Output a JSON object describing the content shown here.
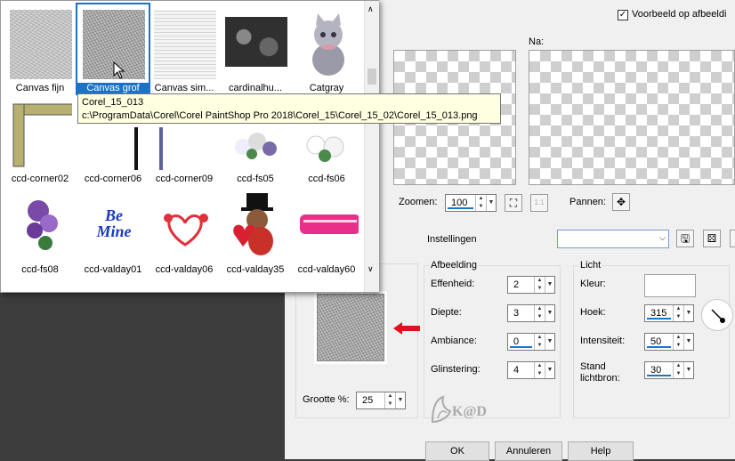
{
  "header": {
    "preview_checkbox_label": "Voorbeeld op afbeeldi",
    "after_label": "Na:"
  },
  "zoom": {
    "label": "Zoomen:",
    "value": "100",
    "pan_label": "Pannen:"
  },
  "settings": {
    "label": "Instellingen",
    "value": ""
  },
  "texture": {
    "size_label": "Grootte %:",
    "size_value": "25"
  },
  "afbeelding": {
    "title": "Afbeelding",
    "fields": [
      {
        "label": "Effenheid:",
        "value": "2"
      },
      {
        "label": "Diepte:",
        "value": "3"
      },
      {
        "label": "Ambiance:",
        "value": "0"
      },
      {
        "label": "Glinstering:",
        "value": "4"
      }
    ]
  },
  "licht": {
    "title": "Licht",
    "kleur_label": "Kleur:",
    "hoek_label": "Hoek:",
    "hoek_value": "315",
    "intensiteit_label": "Intensiteit:",
    "intensiteit_value": "50",
    "stand_label_1": "Stand",
    "stand_label_2": "lichtbron:",
    "stand_value": "30"
  },
  "buttons": {
    "ok": "OK",
    "cancel": "Annuleren",
    "help": "Help"
  },
  "watermark": "K@D",
  "gallery": {
    "items": [
      {
        "label": "Canvas fijn"
      },
      {
        "label": "Canvas grof"
      },
      {
        "label": "Canvas sim..."
      },
      {
        "label": "cardinalhu..."
      },
      {
        "label": "Catgray"
      },
      {
        "label": "ccd-corner02"
      },
      {
        "label": "ccd-corner06"
      },
      {
        "label": "ccd-corner09"
      },
      {
        "label": "ccd-fs05"
      },
      {
        "label": "ccd-fs06"
      },
      {
        "label": "ccd-fs08"
      },
      {
        "label": "ccd-valday01"
      },
      {
        "label": "ccd-valday06"
      },
      {
        "label": "ccd-valday35"
      },
      {
        "label": "ccd-valday60"
      }
    ],
    "balloon_text": "Be Mine",
    "tooltip_title": "Corel_15_013",
    "tooltip_path": "c:\\ProgramData\\Corel\\Corel PaintShop Pro 2018\\Corel_15\\Corel_15_02\\Corel_15_013.png"
  },
  "colors": {
    "accent": "#1a73c8",
    "arrow": "#e0101e"
  }
}
